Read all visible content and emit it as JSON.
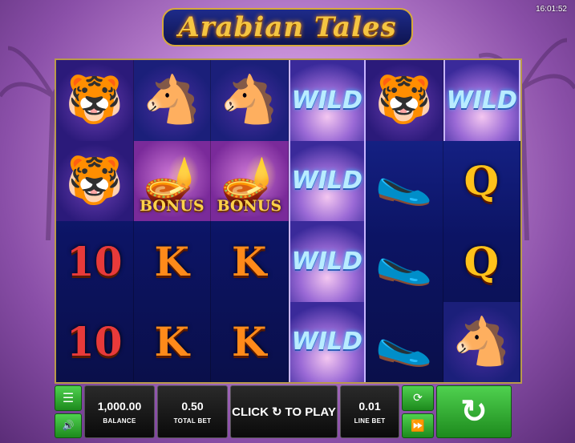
{
  "clock": "16:01:52",
  "logo": "Arabian Tales",
  "reels": [
    [
      {
        "sym": "tiger"
      },
      {
        "sym": "horse"
      },
      {
        "sym": "horse"
      },
      {
        "sym": "wild"
      },
      {
        "sym": "tiger"
      },
      {
        "sym": "wild"
      }
    ],
    [
      {
        "sym": "tiger"
      },
      {
        "sym": "bonus"
      },
      {
        "sym": "bonus"
      },
      {
        "sym": "wild"
      },
      {
        "sym": "slippers"
      },
      {
        "sym": "Q"
      }
    ],
    [
      {
        "sym": "10"
      },
      {
        "sym": "K"
      },
      {
        "sym": "K"
      },
      {
        "sym": "wild"
      },
      {
        "sym": "slippers"
      },
      {
        "sym": "Q"
      }
    ],
    [
      {
        "sym": "10"
      },
      {
        "sym": "K"
      },
      {
        "sym": "K"
      },
      {
        "sym": "wild"
      },
      {
        "sym": "slippers"
      },
      {
        "sym": "horse"
      }
    ]
  ],
  "symbol_text": {
    "wild": "WILD",
    "bonus": "BONUS"
  },
  "symbol_icons": {
    "tiger": "🐯",
    "horse": "🐴",
    "bonus": "🪔",
    "slippers": "🥿"
  },
  "balance": {
    "value": "1,000.00",
    "label": "BALANCE"
  },
  "total_bet": {
    "value": "0.50",
    "label": "TOTAL BET"
  },
  "play_prompt": {
    "before": "CLICK",
    "icon": "↻",
    "after": "TO PLAY"
  },
  "line_bet": {
    "value": "0.01",
    "label": "LINE BET"
  },
  "icons": {
    "menu": "☰",
    "sound": "🔊",
    "autoplay": "⟳",
    "fast_forward": "⏩",
    "spin": "↻"
  }
}
